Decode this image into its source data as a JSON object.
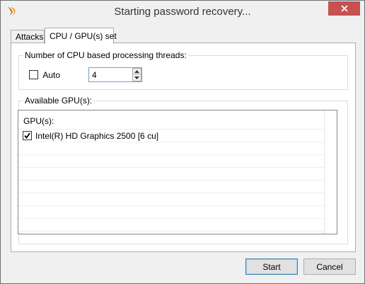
{
  "window": {
    "title": "Starting password recovery...",
    "app_icon": "tasks-flame-icon",
    "close_icon": "close-icon"
  },
  "tabs": [
    {
      "label": "Attacks",
      "active": false
    },
    {
      "label": "CPU / GPU(s) set",
      "active": true
    }
  ],
  "cpu_group": {
    "title": "Number of CPU based processing threads:",
    "auto_label": "Auto",
    "auto_checked": false,
    "threads_value": "4"
  },
  "gpu_group": {
    "title": "Available GPU(s):",
    "column_header": "GPU(s):",
    "items": [
      {
        "label": "Intel(R) HD Graphics 2500 [6 cu]",
        "checked": true
      }
    ]
  },
  "buttons": {
    "start": "Start",
    "cancel": "Cancel"
  },
  "colors": {
    "close_button": "#c75050",
    "default_button_border": "#3c7fb1"
  }
}
